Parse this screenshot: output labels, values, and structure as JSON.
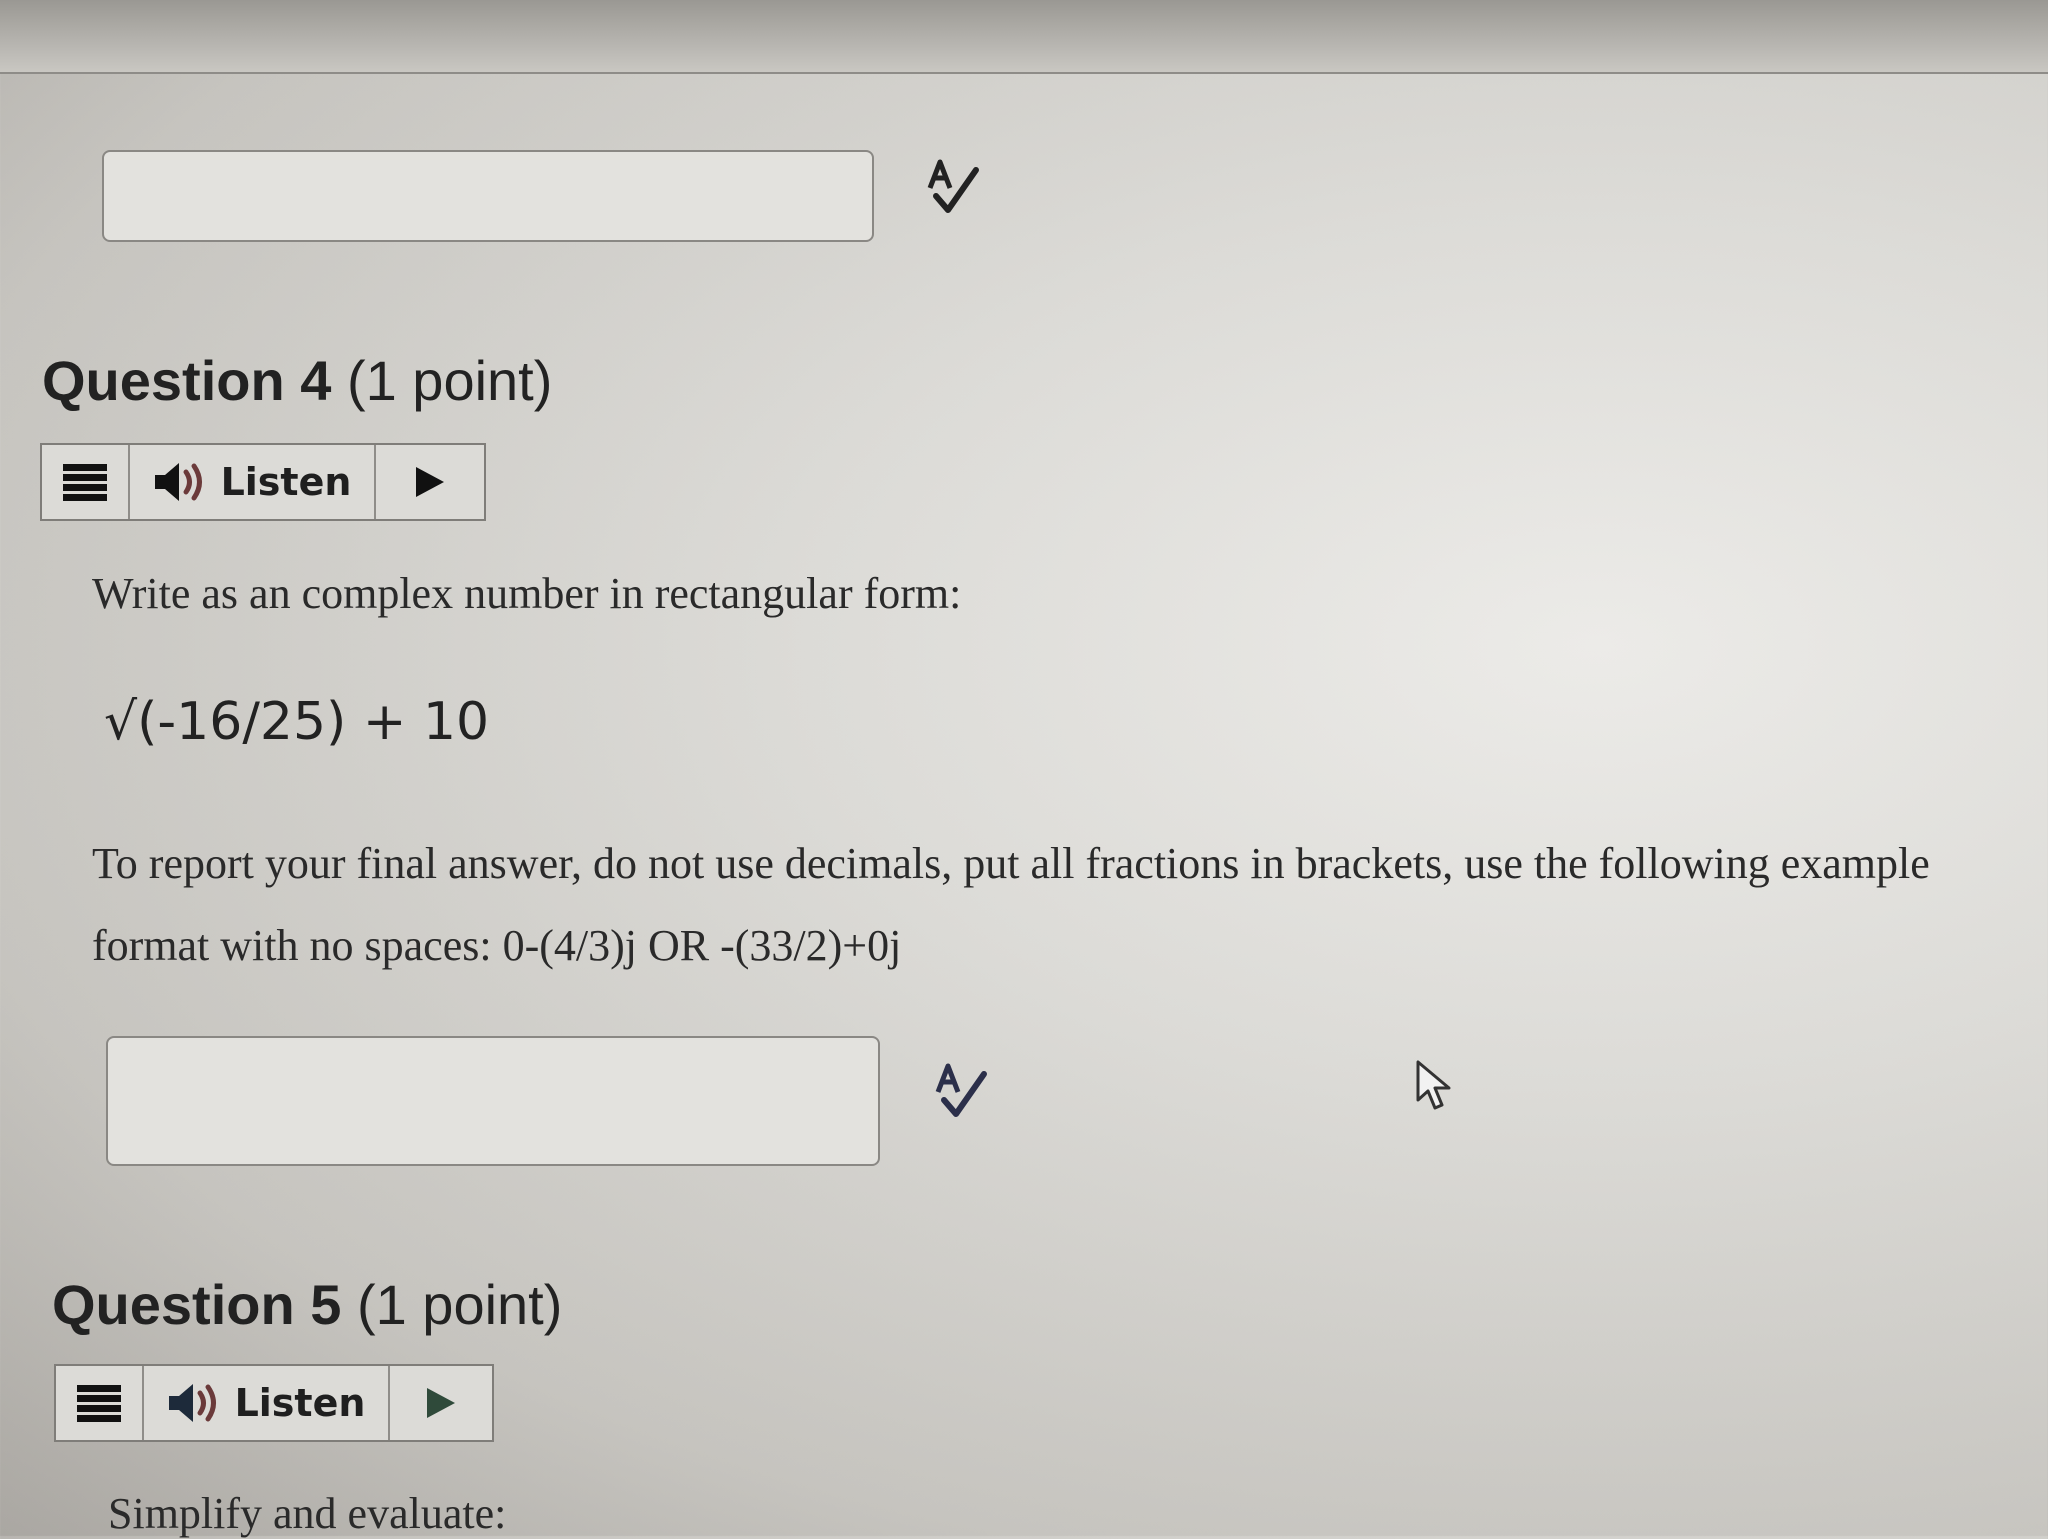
{
  "question4": {
    "label": "Question 4",
    "points": "(1 point)",
    "listen_label": "Listen",
    "prompt": "Write as an complex number in rectangular form:",
    "expression": "√(-16/25)  + 10",
    "instructions_line1": "To report your final answer, do not use decimals, put all fractions in brackets, use the following example",
    "instructions_line2": "format with no spaces: 0-(4/3)j OR -(33/2)+0j"
  },
  "question5": {
    "label": "Question 5",
    "points": "(1 point)",
    "listen_label": "Listen",
    "prompt": "Simplify and evaluate:"
  },
  "icons": {
    "spellcheck": "spellcheck-icon",
    "menu": "menu-icon",
    "speaker": "speaker-icon",
    "play": "play-icon",
    "cursor": "mouse-pointer-icon"
  },
  "colors": {
    "text": "#222222",
    "play_q5": "#2f4a3a"
  }
}
